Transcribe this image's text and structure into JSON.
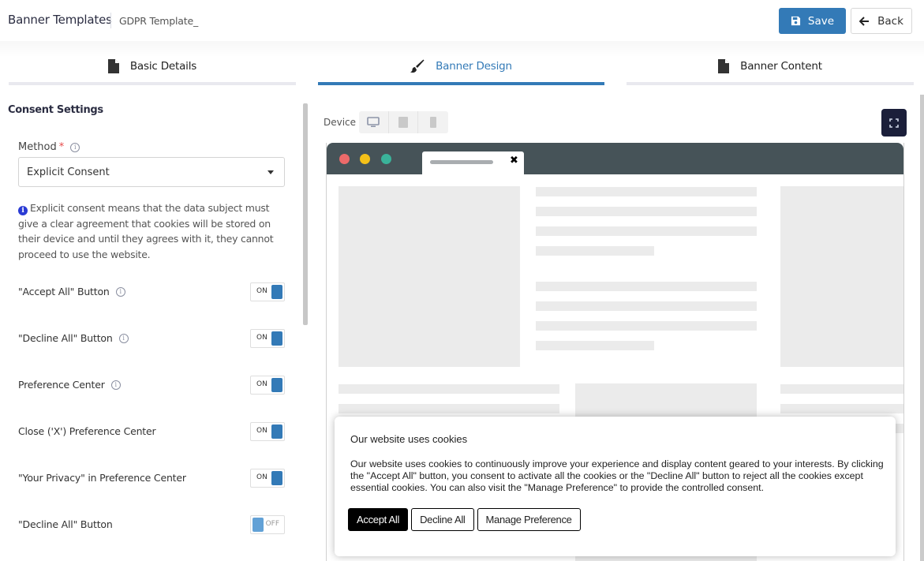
{
  "header": {
    "title": "Banner Templates",
    "breadcrumb": "GDPR Template_",
    "save_label": "Save",
    "back_label": "Back"
  },
  "tabs": [
    {
      "label": "Basic Details",
      "icon": "file-icon",
      "active": false
    },
    {
      "label": "Banner Design",
      "icon": "paint-brush-icon",
      "active": true
    },
    {
      "label": "Banner Content",
      "icon": "file-icon",
      "active": false
    }
  ],
  "consent_settings": {
    "title": "Consent Settings",
    "method": {
      "label": "Method",
      "required_mark": "*",
      "selected": "Explicit Consent"
    },
    "help_text": "Explicit consent means that the data subject must give a clear agreement that cookies will be stored on their device and until they agrees with it, they cannot proceed to use the website.",
    "toggles": [
      {
        "label": "\"Accept All\" Button",
        "info": true,
        "state": "ON"
      },
      {
        "label": "\"Decline All\" Button",
        "info": true,
        "state": "ON"
      },
      {
        "label": "Preference Center",
        "info": true,
        "state": "ON"
      },
      {
        "label": "Close ('X') Preference Center",
        "info": false,
        "state": "ON"
      },
      {
        "label": "\"Your Privacy\" in Preference Center",
        "info": false,
        "state": "ON"
      },
      {
        "label": "\"Decline All\" Button",
        "info": false,
        "state": "OFF"
      }
    ]
  },
  "preview": {
    "device_label": "Device",
    "devices": [
      "desktop-icon",
      "tablet-icon",
      "mobile-icon"
    ],
    "selected_device": "desktop",
    "browser_tab_close": "✖",
    "dot_colors": [
      "#ec6a6a",
      "#f4c119",
      "#3ab39a"
    ],
    "banner": {
      "title": "Our website uses cookies",
      "body": "Our website uses cookies to continuously improve your experience and display content geared to your interests. By clicking the \"Accept All\" button, you consent to activate all the cookies or the \"Decline All\" button to reject all the cookies except essential cookies. You can also visit the \"Manage Preference\" to provide the controlled consent.",
      "buttons": {
        "accept": "Accept All",
        "decline": "Decline All",
        "manage": "Manage Preference"
      }
    }
  },
  "colors": {
    "primary": "#337ab7",
    "fullscreen_button": "#1b1f3a",
    "browser_chrome": "#465358"
  }
}
